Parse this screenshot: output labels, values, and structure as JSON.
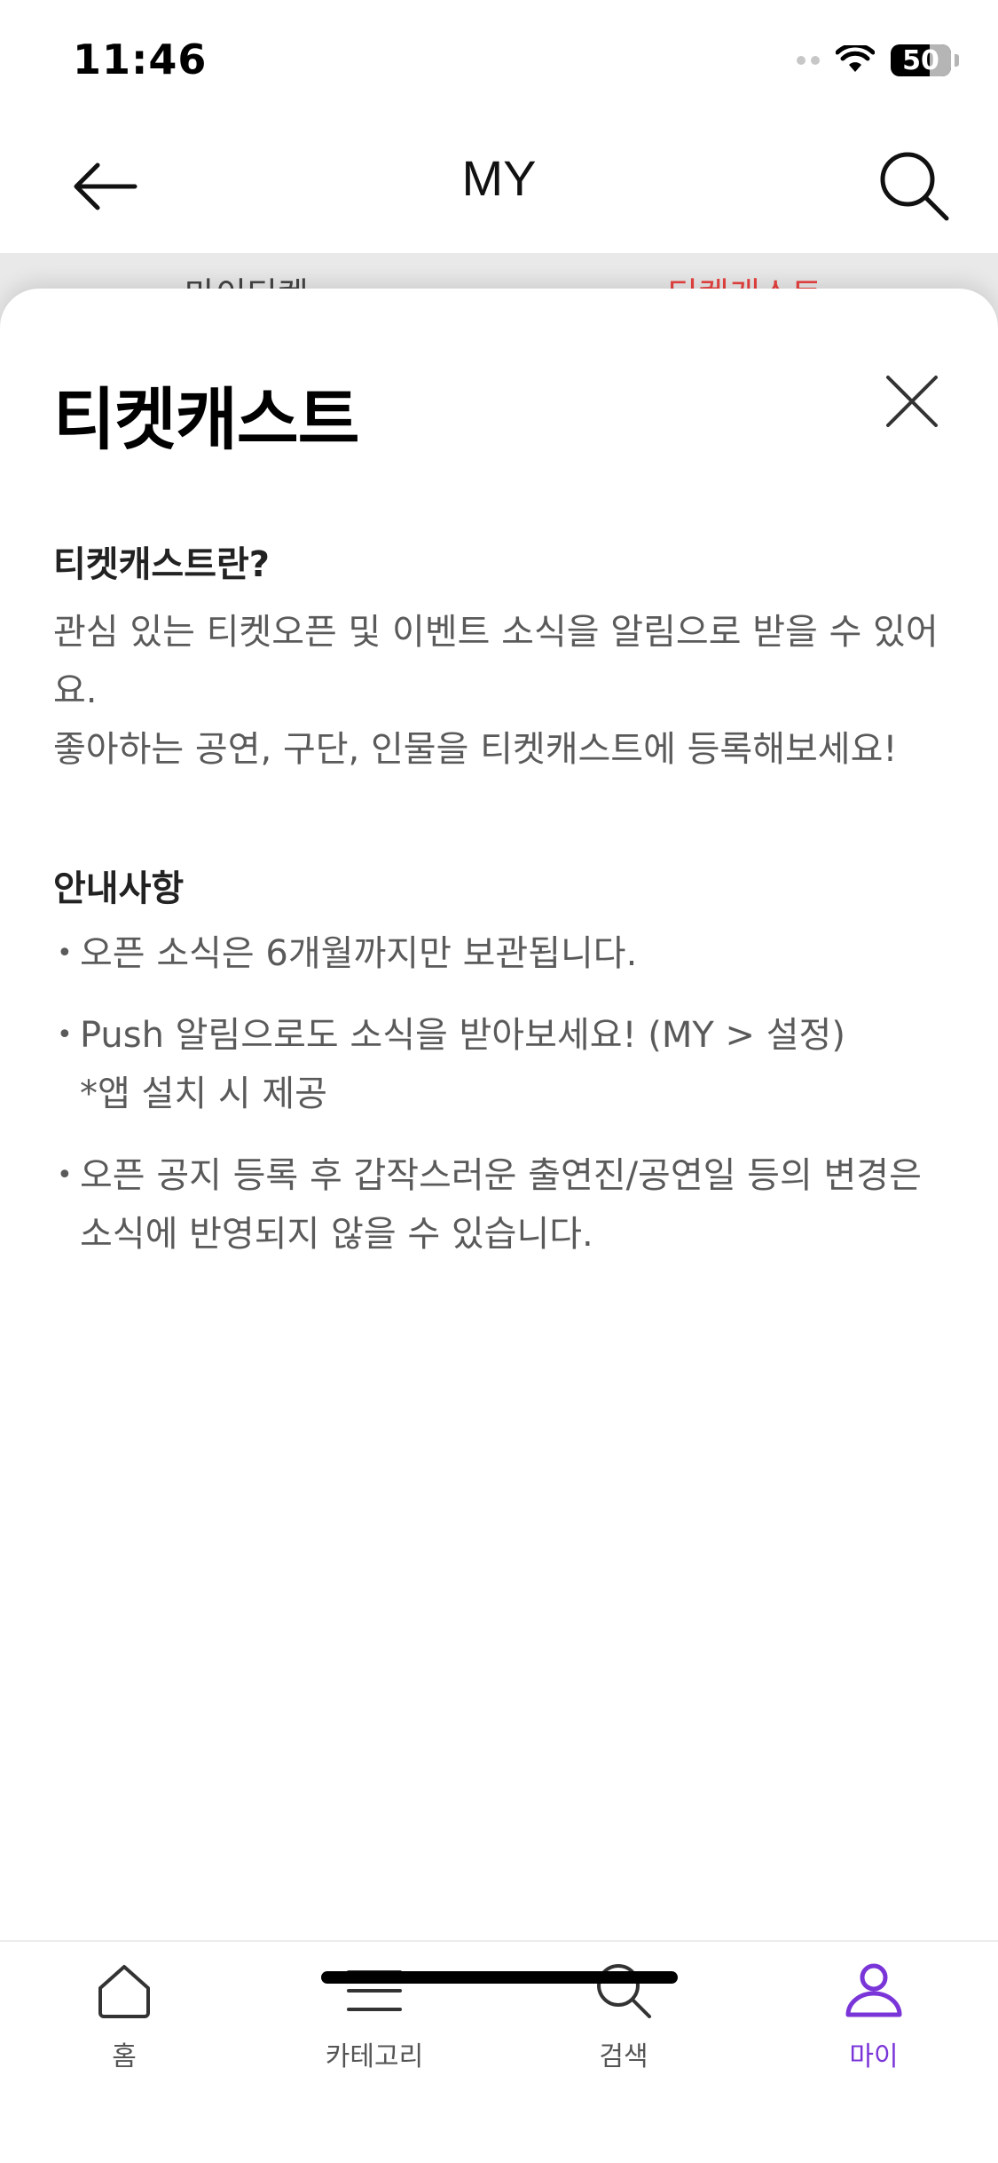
{
  "status_bar": {
    "time": "11:46",
    "battery": "50"
  },
  "header": {
    "title": "MY"
  },
  "under_tabs": [
    {
      "label": "마이티켓"
    },
    {
      "label": "티켓캐스트"
    }
  ],
  "sheet": {
    "title": "티켓캐스트",
    "intro_heading": "티켓캐스트란?",
    "intro_text": "관심 있는 티켓오픈 및 이벤트 소식을 알림으로 받을 수 있어요.\n좋아하는 공연, 구단, 인물을 티켓캐스트에 등록해보세요!",
    "notice_heading": "안내사항",
    "notices": [
      "오픈 소식은 6개월까지만 보관됩니다.",
      "Push 알림으로도 소식을 받아보세요! (MY > 설정)\n*앱 설치 시 제공",
      "오픈 공지 등록 후 갑작스러운 출연진/공연일 등의 변경은 소식에 반영되지 않을 수 있습니다."
    ]
  },
  "tab_bar": {
    "items": [
      {
        "label": "홈",
        "icon": "home-icon"
      },
      {
        "label": "카테고리",
        "icon": "menu-icon"
      },
      {
        "label": "검색",
        "icon": "search-icon"
      },
      {
        "label": "마이",
        "icon": "person-icon"
      }
    ],
    "active_color": "#7a35d8"
  }
}
